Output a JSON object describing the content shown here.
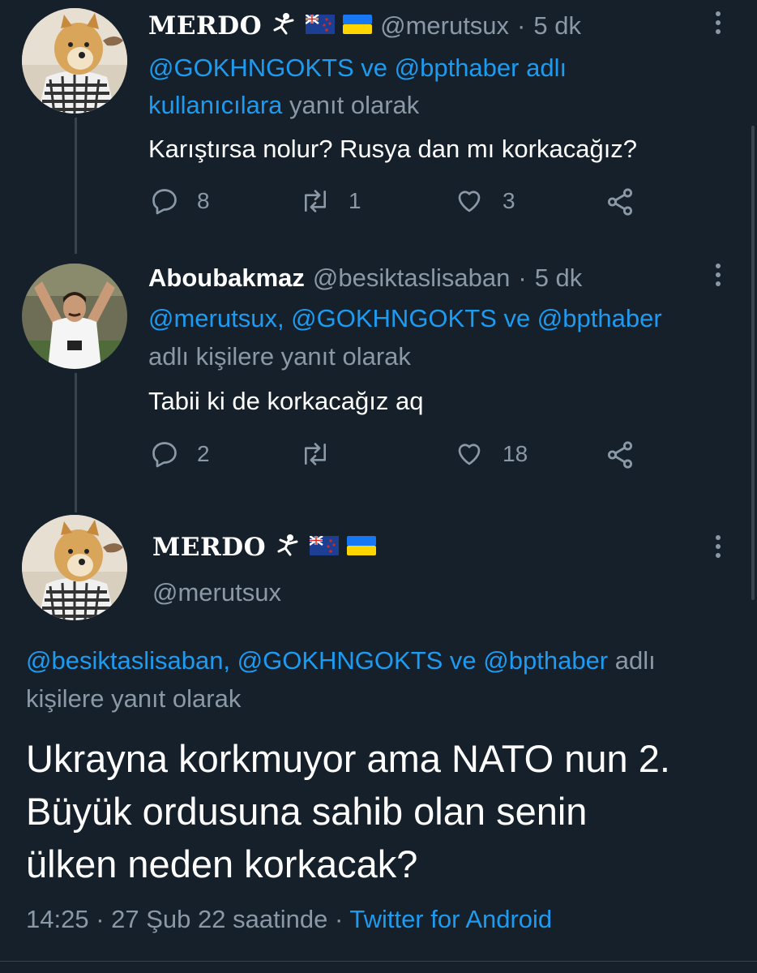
{
  "tweet1": {
    "name": "MERDO",
    "handle": "@merutsux",
    "time": "5 dk",
    "reply_mentions_1": "@GOKHNGOKTS ve @bpthaber adlı",
    "reply_mentions_2": "kullanıcılara",
    "reply_suffix": "yanıt olarak",
    "text": "Karıştırsa nolur? Rusya dan mı korkacağız?",
    "replies": "8",
    "retweets": "1",
    "likes": "3"
  },
  "tweet2": {
    "name": "Aboubakmaz",
    "handle": "@besiktaslisaban",
    "time": "5 dk",
    "reply_mentions": "@merutsux, @GOKHNGOKTS ve @bpthaber",
    "reply_suffix": "adlı kişilere yanıt olarak",
    "text": "Tabii ki de korkacağız aq",
    "replies": "2",
    "retweets": "",
    "likes": "18"
  },
  "main": {
    "name": "MERDO",
    "handle": "@merutsux",
    "reply_mentions": "@besiktaslisaban, @GOKHNGOKTS ve @bpthaber",
    "reply_suffix_1": "adlı",
    "reply_suffix_2": "kişilere yanıt olarak",
    "text_line1": "Ukrayna korkmuyor ama NATO nun 2.",
    "text_line2": "Büyük ordusuna sahib olan senin",
    "text_line3": "ülken neden korkacak?",
    "time": "14:25",
    "date": "27 Şub 22 saatinde",
    "source": "Twitter for Android"
  },
  "colors": {
    "background": "#15202b",
    "accent": "#1d9bf0",
    "muted": "#8b98a5",
    "thread_line": "#38444d"
  },
  "icons": {
    "reply": "reply-icon",
    "retweet": "retweet-icon",
    "like": "heart-icon",
    "share": "share-icon",
    "more": "more-vertical-icon",
    "flag_nz": "new-zealand-flag-icon",
    "flag_ua": "ukraine-flag-icon",
    "kickboxer": "kickboxer-icon"
  }
}
